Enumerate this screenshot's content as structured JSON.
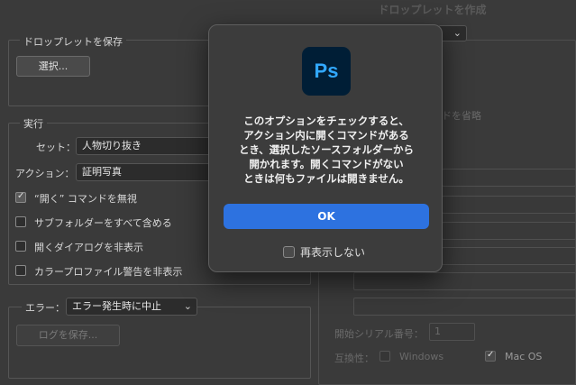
{
  "window": {
    "title": "ドロップレットを作成"
  },
  "save_group": {
    "label": "ドロップレットを保存",
    "choose_button": "選択..."
  },
  "run_group": {
    "label": "実行",
    "set_label": "セット：",
    "set_value": "人物切り抜き",
    "action_label": "アクション：",
    "action_value": "証明写真",
    "options": [
      {
        "label": "“開く” コマンドを無視",
        "checked": true
      },
      {
        "label": "サブフォルダーをすべて含める",
        "checked": false
      },
      {
        "label": "開くダイアログを非表示",
        "checked": false
      },
      {
        "label": "カラープロファイル警告を非表示",
        "checked": false
      }
    ]
  },
  "error_group": {
    "label": "エラー：",
    "value": "エラー発生時に中止",
    "save_log_button": "ログを保存..."
  },
  "right_panel": {
    "omit_text": "ドを省略",
    "serial_label": "開始シリアル番号：",
    "serial_value": "1",
    "compat_label": "互換性：",
    "windows_label": "Windows",
    "macos_label": "Mac OS"
  },
  "dialog": {
    "logo_text": "Ps",
    "message_lines": [
      "このオプションをチェックすると、",
      "アクション内に開くコマンドがある",
      "とき、選択したソースフォルダーから",
      "開かれます。開くコマンドがない",
      "ときは何もファイルは開きません。"
    ],
    "ok_button": "OK",
    "dont_show_label": "再表示しない"
  },
  "colors": {
    "accent": "#2d72e0",
    "ps_bg": "#001e36",
    "ps_fg": "#31a8ff"
  }
}
